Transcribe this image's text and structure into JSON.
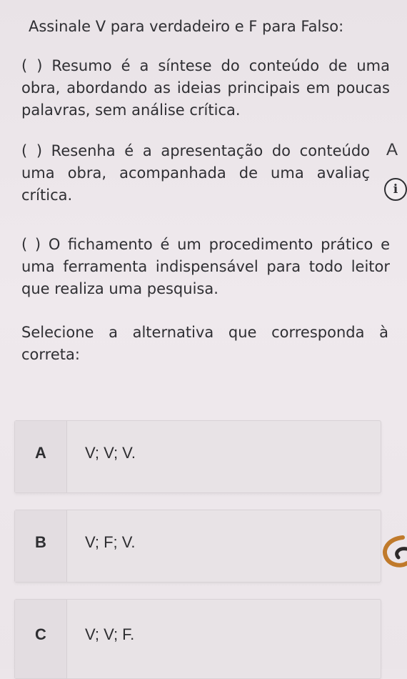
{
  "question": {
    "instruction": "Assinale V para verdadeiro e F para Falso:",
    "statements": [
      "( ) Resumo é a síntese do conteúdo de uma obra, abordando as ideias principais em poucas palavras, sem análise crítica.",
      "( ) Resenha é a apresentação do conteúdo uma obra, acompanhada de uma avaliaç crítica.",
      "( ) O fichamento é um procedimento prático e uma ferramenta indispensável para todo leitor que realiza uma pesquisa."
    ],
    "prompt": "Selecione a alternativa que corresponda à correta:"
  },
  "side_panel": {
    "tab_letter": "A",
    "info_icon": "info-icon",
    "loading_icon": "loading-spinner-icon"
  },
  "options": [
    {
      "letter": "A",
      "text": "V; V; V."
    },
    {
      "letter": "B",
      "text": "V; F; V."
    },
    {
      "letter": "C",
      "text": "V; V; F."
    }
  ],
  "colors": {
    "background": "#ece6ea",
    "card": "#e8e3e6",
    "text": "#2e2e31",
    "spinner": "#c07a2b"
  }
}
